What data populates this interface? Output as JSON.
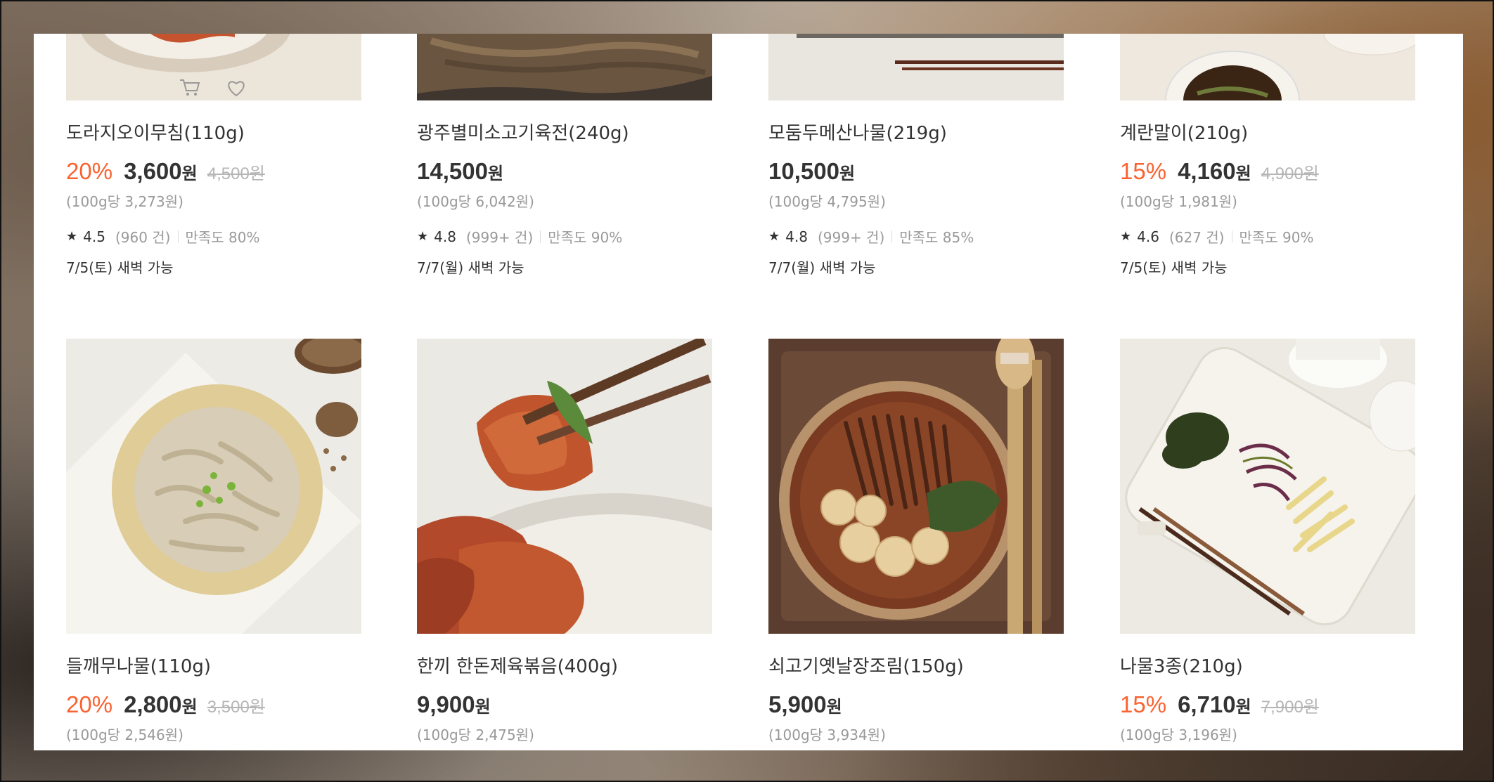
{
  "products_row1": [
    {
      "name": "도라지오이무침(110g)",
      "discount": "20%",
      "price": "3,600",
      "won": "원",
      "original": "4,500원",
      "unit_price": "(100g당 3,273원)",
      "rating": "4.5",
      "reviews": "(960 건)",
      "satisfaction": "만족도 80%",
      "delivery": "7/5(토) 새벽 가능"
    },
    {
      "name": "광주별미소고기육전(240g)",
      "discount": "",
      "price": "14,500",
      "won": "원",
      "original": "",
      "unit_price": "(100g당 6,042원)",
      "rating": "4.8",
      "reviews": "(999+ 건)",
      "satisfaction": "만족도 90%",
      "delivery": "7/7(월) 새벽 가능"
    },
    {
      "name": "모둠두메산나물(219g)",
      "discount": "",
      "price": "10,500",
      "won": "원",
      "original": "",
      "unit_price": "(100g당 4,795원)",
      "rating": "4.8",
      "reviews": "(999+ 건)",
      "satisfaction": "만족도 85%",
      "delivery": "7/7(월) 새벽 가능"
    },
    {
      "name": "계란말이(210g)",
      "discount": "15%",
      "price": "4,160",
      "won": "원",
      "original": "4,900원",
      "unit_price": "(100g당 1,981원)",
      "rating": "4.6",
      "reviews": "(627 건)",
      "satisfaction": "만족도 90%",
      "delivery": "7/5(토) 새벽 가능"
    }
  ],
  "products_row2": [
    {
      "name": "들깨무나물(110g)",
      "discount": "20%",
      "price": "2,800",
      "won": "원",
      "original": "3,500원",
      "unit_price": "(100g당 2,546원)"
    },
    {
      "name": "한끼 한돈제육볶음(400g)",
      "discount": "",
      "price": "9,900",
      "won": "원",
      "original": "",
      "unit_price": "(100g당 2,475원)"
    },
    {
      "name": "쇠고기옛날장조림(150g)",
      "discount": "",
      "price": "5,900",
      "won": "원",
      "original": "",
      "unit_price": "(100g당 3,934원)"
    },
    {
      "name": "나물3종(210g)",
      "discount": "15%",
      "price": "6,710",
      "won": "원",
      "original": "7,900원",
      "unit_price": "(100g당 3,196원)"
    }
  ],
  "icons": {
    "cart": "cart-icon",
    "heart": "heart-icon",
    "star": "star-icon"
  },
  "colors": {
    "discount": "#fa622f",
    "text": "#333333",
    "muted": "#999999"
  }
}
